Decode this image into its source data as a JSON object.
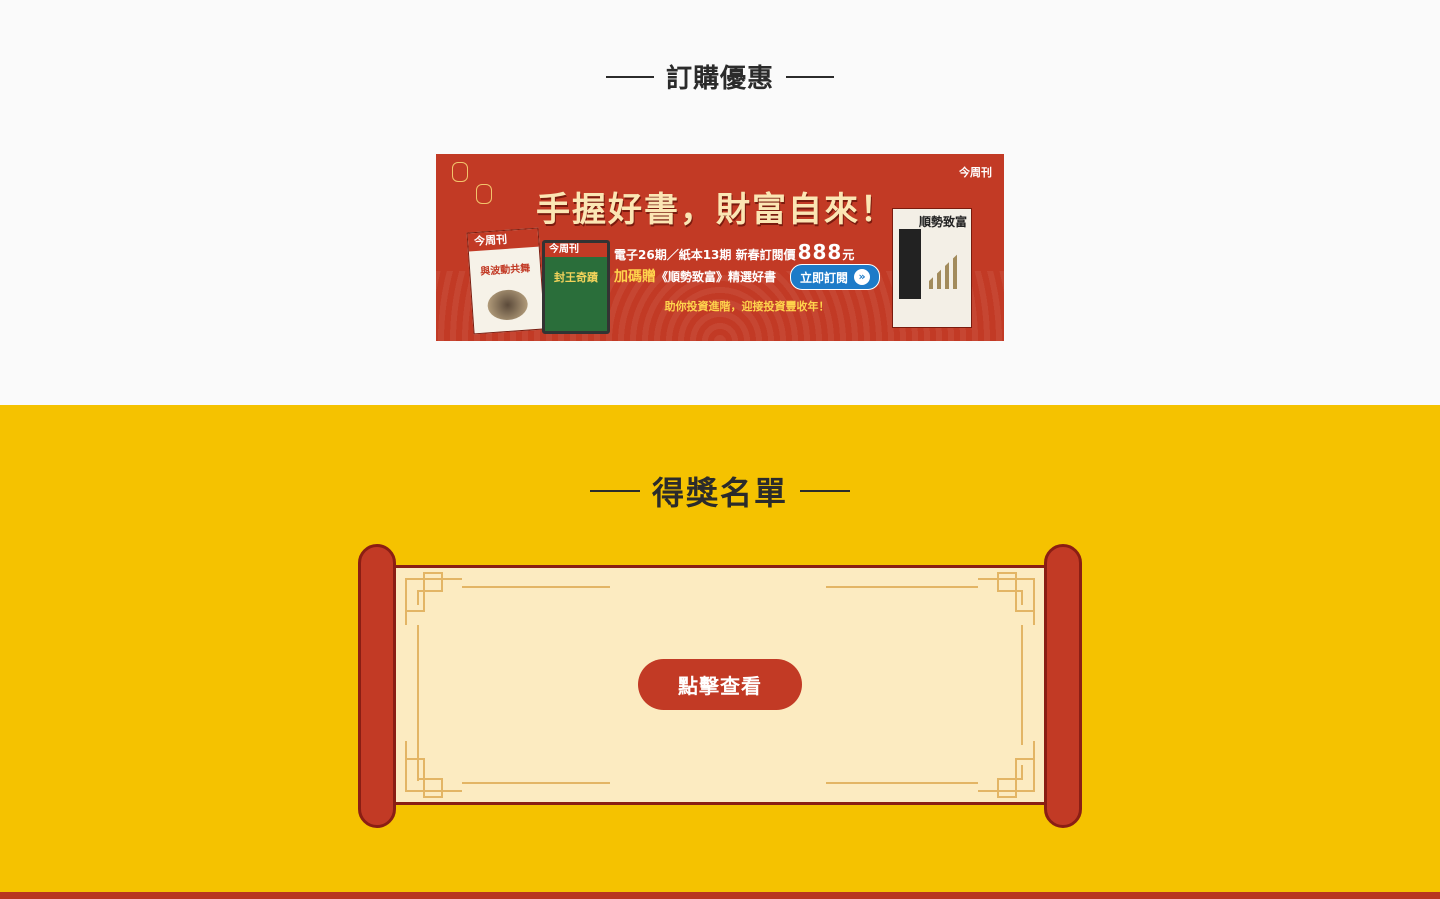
{
  "subscribe_section": {
    "title": "訂購優惠",
    "banner": {
      "headline": "手握好書，財富自來！",
      "brand": "今周刊",
      "mag1_masthead": "今周刊",
      "mag1_cover_text": "與波動共舞",
      "mag2_masthead": "今周刊",
      "mag2_cover_text": "封王奇蹟",
      "offer_line": "電子26期／紙本13期 新春訂閱價",
      "price": "888",
      "price_unit": "元",
      "gift_prefix": "加碼贈",
      "gift_text": "《順勢致富》精選好書",
      "cta_label": "立即訂閱",
      "tagline": "助你投資進階，迎接投資豐收年！",
      "book_title": "順勢致富",
      "colors": {
        "banner_bg": "#c23a25",
        "cta_bg": "#1d7bc8",
        "gold": "#ffd44c"
      }
    }
  },
  "winners_section": {
    "title": "得獎名單",
    "view_button_label": "點擊查看",
    "colors": {
      "section_bg": "#f5c200",
      "scroll_paper": "#fcebc1",
      "roller": "#c23a25"
    }
  }
}
